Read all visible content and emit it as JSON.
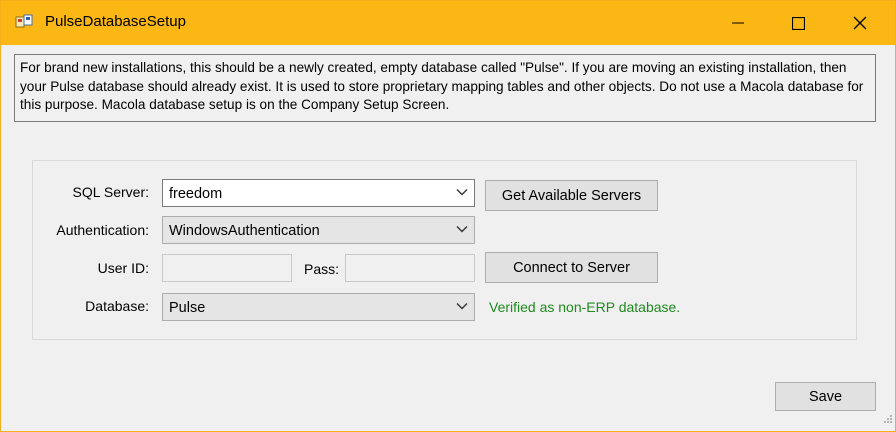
{
  "window": {
    "title": "PulseDatabaseSetup"
  },
  "info_text": "For brand new installations, this should be a newly created, empty database called \"Pulse\". If you are moving an existing installation, then your Pulse database should already exist.   It is used to store proprietary mapping tables and other objects.  Do not use a Macola database for this purpose.  Macola database setup is on the Company Setup Screen.",
  "form": {
    "sql_server_label": "SQL Server:",
    "sql_server_value": "freedom",
    "get_servers_button": "Get Available Servers",
    "auth_label": "Authentication:",
    "auth_value": "WindowsAuthentication",
    "userid_label": "User ID:",
    "userid_value": "",
    "pass_label": "Pass:",
    "pass_value": "",
    "connect_button": "Connect to Server",
    "database_label": "Database:",
    "database_value": "Pulse",
    "status_text": "Verified as non-ERP database."
  },
  "footer": {
    "save_button": "Save"
  },
  "colors": {
    "titlebar": "#fbb713",
    "status": "#1f8a1f"
  }
}
